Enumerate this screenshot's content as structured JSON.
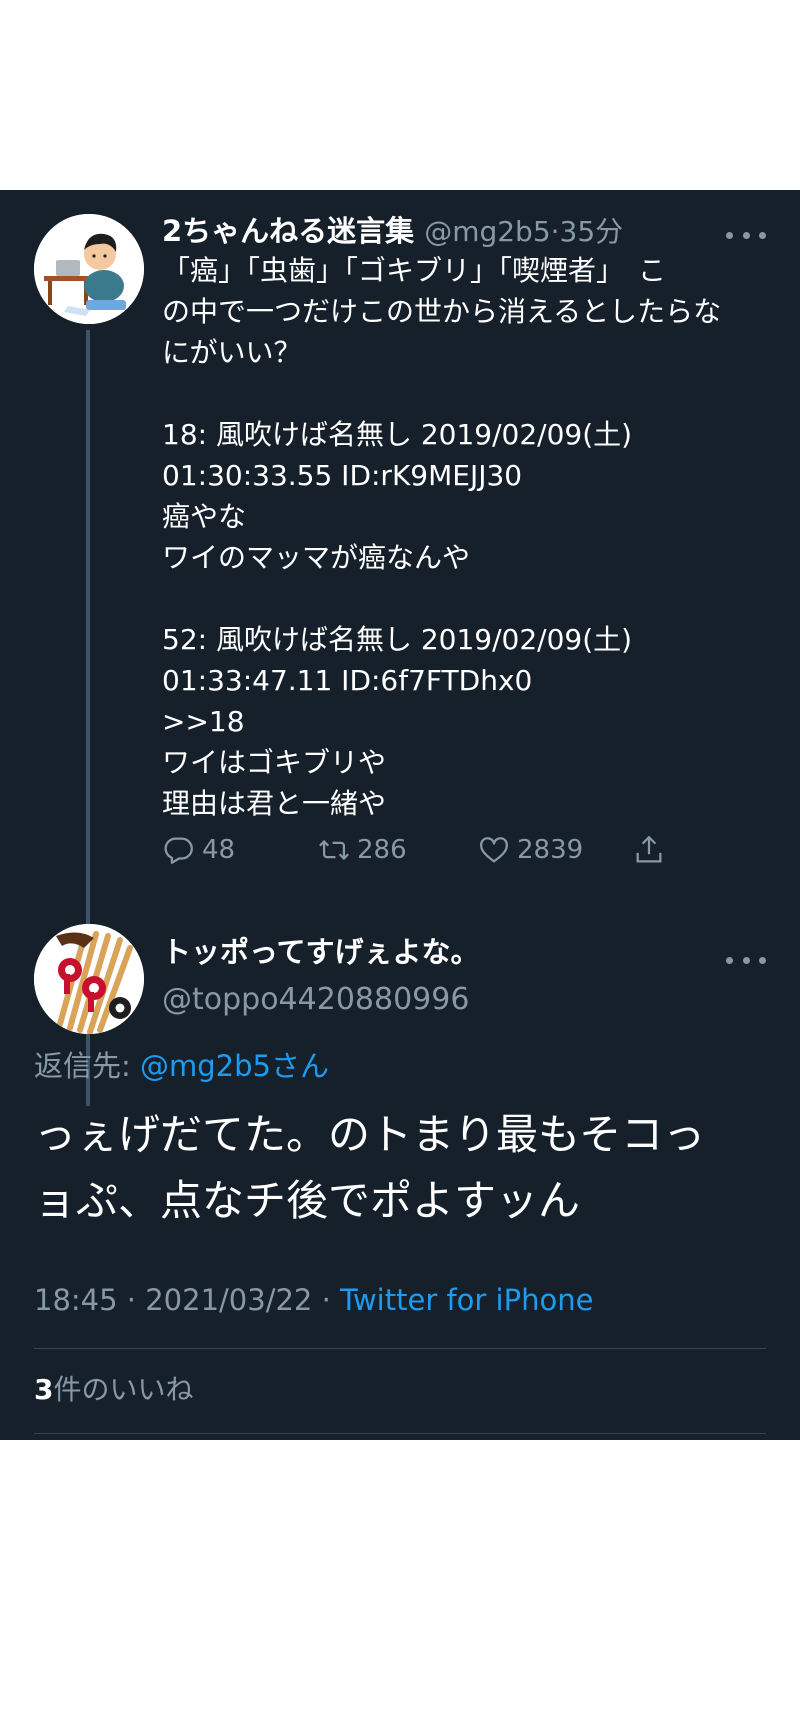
{
  "parent_tweet": {
    "display_name": "2ちゃんねる迷言集",
    "handle": "@mg2b5",
    "separator": "·",
    "time_ago": "35分",
    "body_lines": [
      "「癌」「虫歯」「ゴキブリ」「喫煙者」　こ",
      "の中で一つだけこの世から消えるとしたらな",
      "にがいい？",
      "",
      "18: 風吹けば名無し 2019/02/09(土)",
      "01:30:33.55 ID:rK9MEJJ30",
      "癌やな",
      "ワイのマッマが癌なんや",
      "",
      "52: 風吹けば名無し 2019/02/09(土)",
      "01:33:47.11 ID:6f7FTDhx0",
      ">>18",
      "ワイはゴキブリや",
      "理由は君と一緒や"
    ],
    "actions": {
      "reply_count": "48",
      "retweet_count": "286",
      "like_count": "2839"
    }
  },
  "reply_tweet": {
    "display_name": "トッポってすげぇよな。",
    "handle": "@toppo4420880996",
    "reply_to_label": "返信先: ",
    "reply_to_handle": "@mg2b5さん",
    "body_lines": [
      "っぇげだてた。のトまり最もそコっ",
      "ョぷ、点なチ後でポよすッん"
    ],
    "time": "18:45",
    "date": "2021/03/22",
    "separator": "·",
    "source": "Twitter for iPhone",
    "likes_count": "3",
    "likes_label": "件のいいね"
  },
  "colors": {
    "background": "#15202b",
    "secondary_text": "#8899a6",
    "link": "#1d9bf0",
    "divider": "#38444d"
  },
  "icons": [
    "avatar-illustration",
    "avatar-toppo",
    "more-icon",
    "reply-icon",
    "retweet-icon",
    "like-icon",
    "share-icon"
  ]
}
